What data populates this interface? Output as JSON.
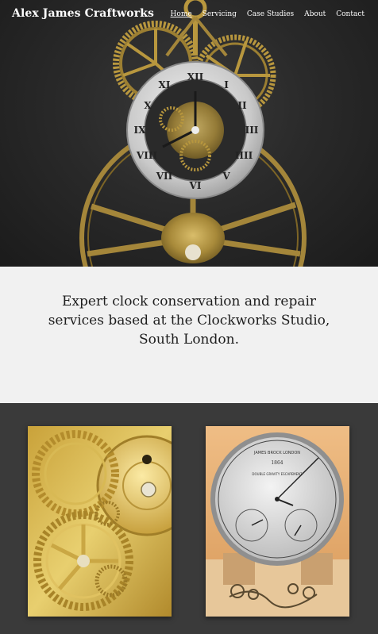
{
  "site": {
    "brand": "Alex James Craftworks"
  },
  "nav": {
    "items": [
      {
        "label": "Home",
        "active": true
      },
      {
        "label": "Servicing",
        "active": false
      },
      {
        "label": "Case Studies",
        "active": false
      },
      {
        "label": "About",
        "active": false
      },
      {
        "label": "Contact",
        "active": false
      }
    ]
  },
  "intro": {
    "text": "Expert clock conservation and repair services based at the Clockworks Studio, South London."
  },
  "gallery": {
    "images": [
      {
        "name": "brass-gear-movement-photo"
      },
      {
        "name": "silver-dial-clock-photo",
        "dial_text": "JAMES BROCK LONDON",
        "dial_year": "1864",
        "dial_subtext": "DOUBLE GRAVITY ESCAPEMENT"
      }
    ]
  },
  "colors": {
    "hero_bg": "#2a2a2a",
    "intro_bg": "#f1f1f1",
    "gallery_bg": "#3a3a3a",
    "brass": "#b8973e",
    "dial_silver": "#d6d6d6"
  }
}
